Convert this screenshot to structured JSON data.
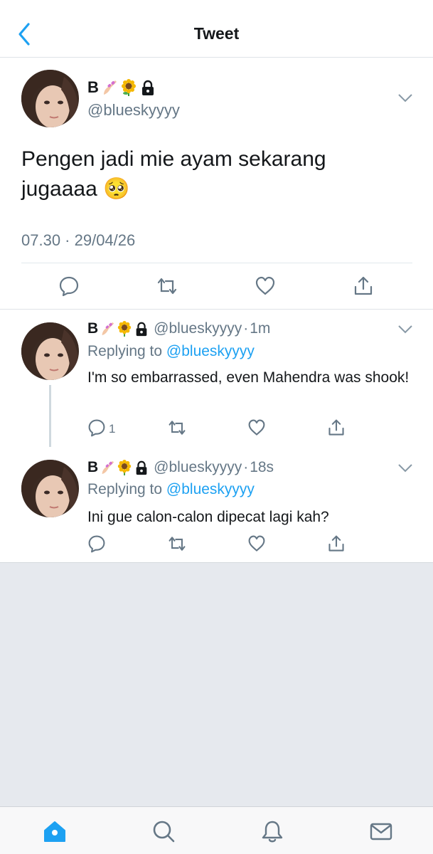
{
  "header": {
    "title": "Tweet"
  },
  "main_tweet": {
    "name": "B",
    "handle": "@blueskyyyy",
    "text": "Pengen jadi mie ayam sekarang jugaaaa 🥺",
    "timestamp": "07.30 · 29/04/26",
    "name_emojis": [
      "nail-polish-emoji",
      "sunflower-emoji",
      "lock-icon"
    ]
  },
  "replies": [
    {
      "name": "B",
      "handle": "@blueskyyyy",
      "separator": "·",
      "age": "1m",
      "replying_prefix": "Replying to ",
      "replying_to": "@blueskyyyy",
      "text": "I'm so embarrassed, even Mahendra was shook!",
      "reply_count": "1"
    },
    {
      "name": "B",
      "handle": "@blueskyyyy",
      "separator": "·",
      "age": "18s",
      "replying_prefix": "Replying to ",
      "replying_to": "@blueskyyyy",
      "text": "Ini gue calon-calon dipecat lagi kah?",
      "reply_count": ""
    }
  ],
  "colors": {
    "accent": "#1da1f2",
    "icon_gray": "#657786",
    "background_gray": "#e6e9ee"
  },
  "bottom_nav": [
    "home-icon",
    "search-icon",
    "notifications-icon",
    "messages-icon"
  ]
}
